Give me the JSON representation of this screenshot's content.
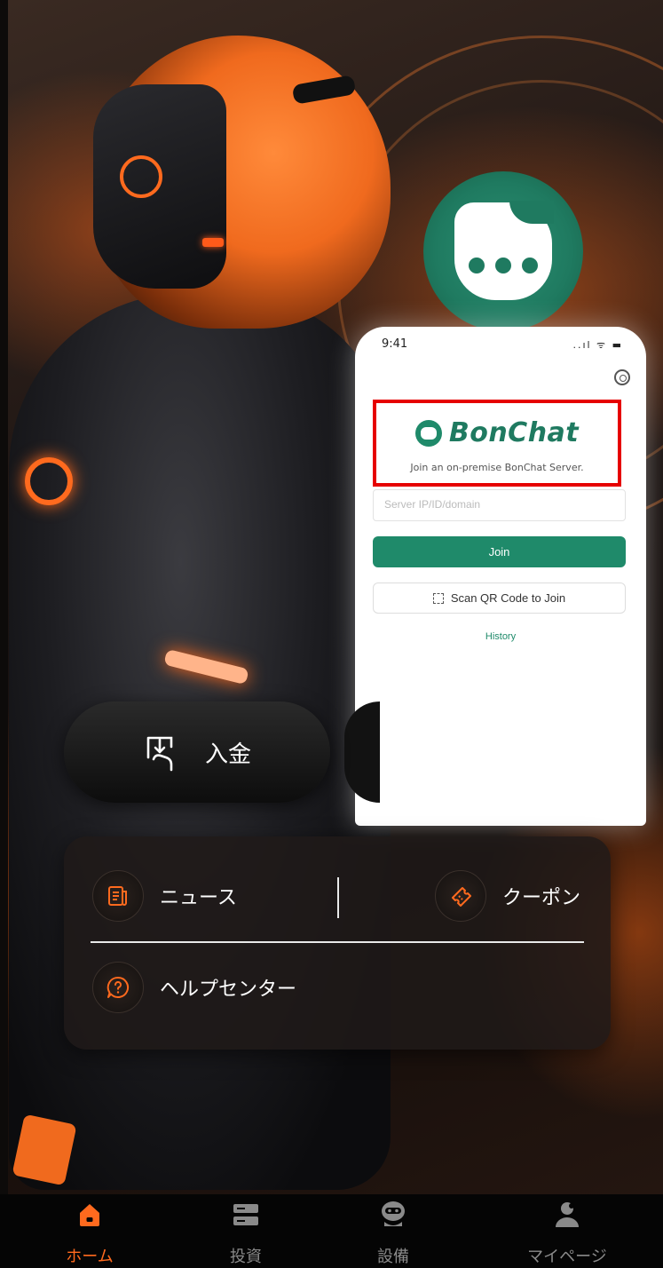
{
  "overlay": {
    "status_time": "9:41",
    "status_icons": "..ıl ᯤ ▬",
    "brand_name": "BonChat",
    "brand_subtitle": "Join an on-premise BonChat Server.",
    "server_placeholder": "Server IP/ID/domain",
    "join_label": "Join",
    "scan_label": "Scan QR Code to Join",
    "history_label": "History",
    "brand_color": "#1f8a6a",
    "highlight_color": "#e60000"
  },
  "actions": {
    "deposit_label": "入金"
  },
  "menu": {
    "news_label": "ニュース",
    "coupon_label": "クーポン",
    "help_label": "ヘルプセンター",
    "icon_color": "#ff6a1e"
  },
  "tabbar": {
    "items": [
      {
        "label": "ホーム",
        "icon": "home-icon",
        "active": true
      },
      {
        "label": "投資",
        "icon": "server-icon",
        "active": false
      },
      {
        "label": "設備",
        "icon": "robot-icon",
        "active": false
      },
      {
        "label": "マイページ",
        "icon": "user-icon",
        "active": false
      }
    ],
    "active_color": "#ff6a1e"
  }
}
